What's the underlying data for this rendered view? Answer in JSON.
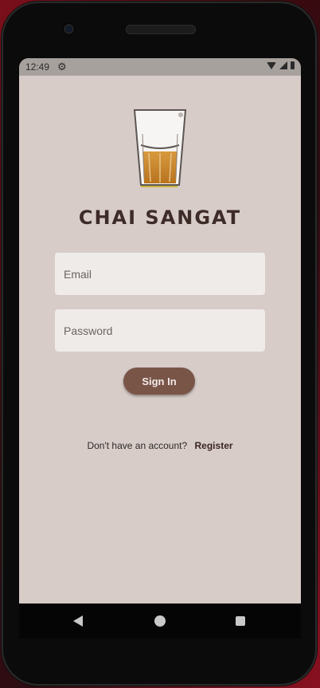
{
  "status_bar": {
    "time": "12:49",
    "icons": [
      "settings-icon",
      "wifi-icon",
      "signal-icon",
      "battery-icon"
    ]
  },
  "app": {
    "title": "CHAI SANGAT",
    "logo": "chai-glass-icon"
  },
  "login_form": {
    "email_placeholder": "Email",
    "password_placeholder": "Password",
    "sign_in_label": "Sign In"
  },
  "register": {
    "prompt": "Don't have an account?",
    "link_label": "Register"
  },
  "nav_bar": {
    "icons": [
      "back-icon",
      "home-icon",
      "recents-icon"
    ]
  },
  "colors": {
    "background": "#d7ccc8",
    "field": "#efebe9",
    "accent": "#795548",
    "title": "#3d2b28"
  }
}
